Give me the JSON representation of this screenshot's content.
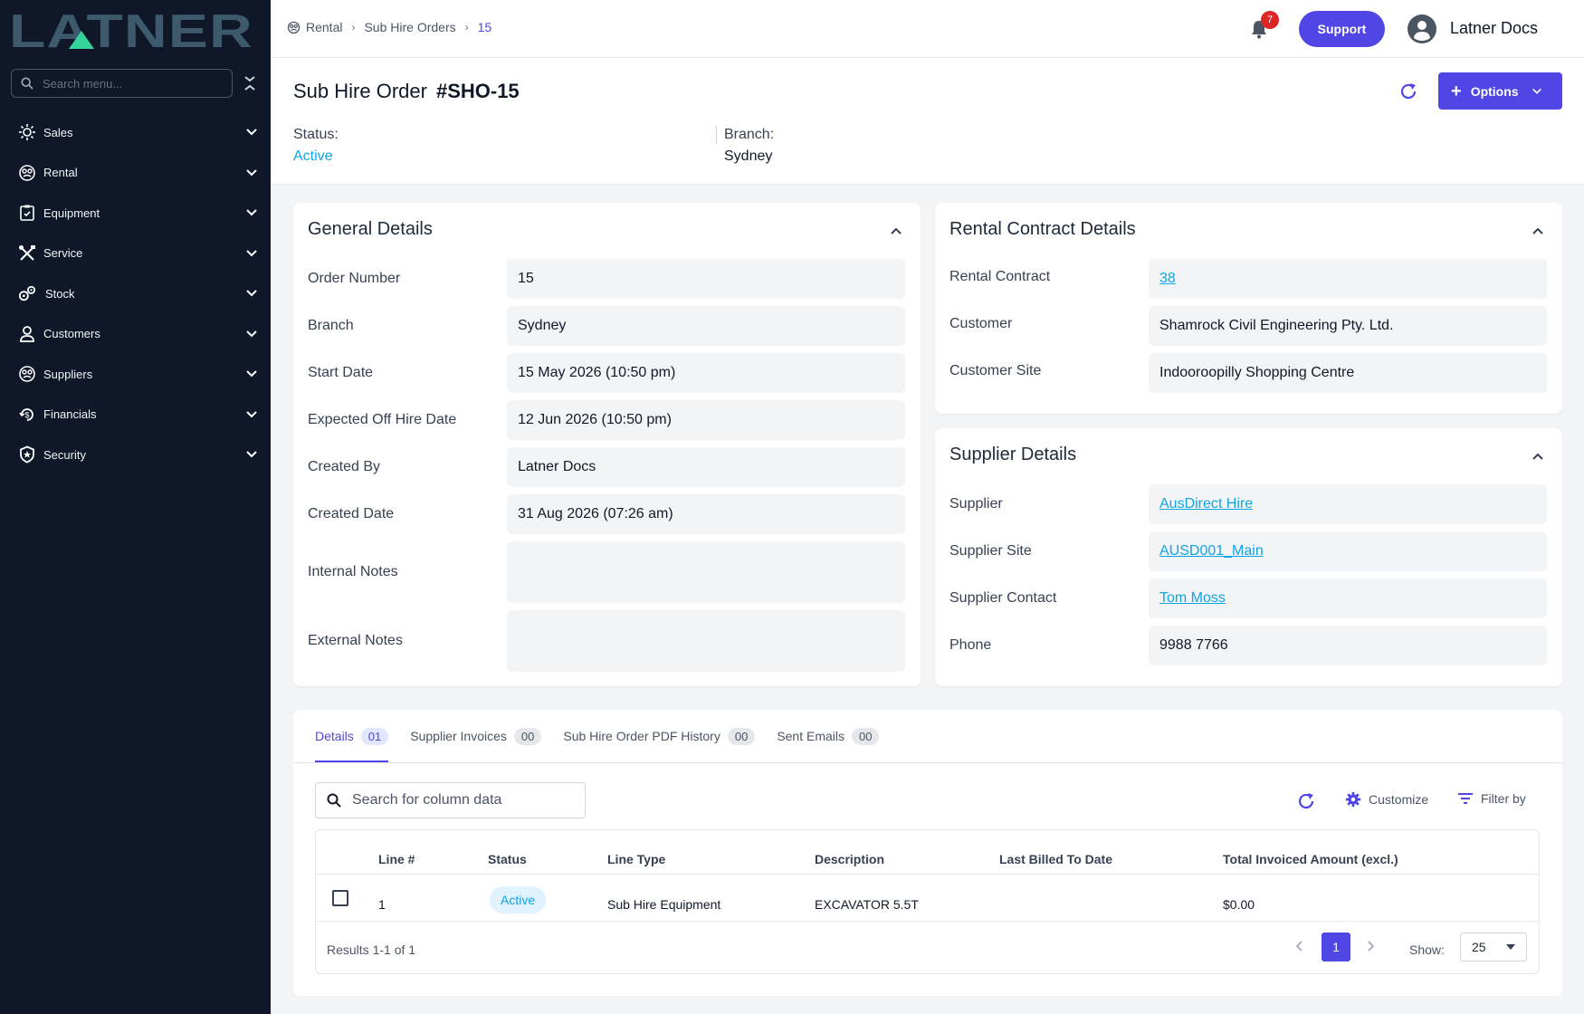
{
  "app": {
    "logo_text": "LATNER"
  },
  "sidebar": {
    "search_placeholder": "Search menu...",
    "items": [
      {
        "label": "Sales",
        "icon": "sun-icon"
      },
      {
        "label": "Rental",
        "icon": "rental-icon"
      },
      {
        "label": "Equipment",
        "icon": "clipboard-icon"
      },
      {
        "label": "Service",
        "icon": "tools-icon"
      },
      {
        "label": "Stock",
        "icon": "gears-icon"
      },
      {
        "label": "Customers",
        "icon": "person-icon"
      },
      {
        "label": "Suppliers",
        "icon": "supplier-icon"
      },
      {
        "label": "Financials",
        "icon": "dollar-icon"
      },
      {
        "label": "Security",
        "icon": "shield-icon"
      }
    ]
  },
  "topbar": {
    "breadcrumb": [
      "Rental",
      "Sub Hire Orders",
      "15"
    ],
    "notification_count": "7",
    "support_label": "Support",
    "user_name": "Latner Docs"
  },
  "header": {
    "title_prefix": "Sub Hire Order",
    "order_code": "#SHO-15",
    "options_label": "Options",
    "status_label": "Status:",
    "status_value": "Active",
    "branch_label": "Branch:",
    "branch_value": "Sydney"
  },
  "general": {
    "title": "General Details",
    "fields": [
      {
        "label": "Order Number",
        "value": "15"
      },
      {
        "label": "Branch",
        "value": "Sydney"
      },
      {
        "label": "Start Date",
        "value": "15 May 2026 (10:50 pm)"
      },
      {
        "label": "Expected Off Hire Date",
        "value": "12 Jun 2026 (10:50 pm)"
      },
      {
        "label": "Created By",
        "value": "Latner Docs"
      },
      {
        "label": "Created Date",
        "value": "31 Aug 2026 (07:26 am)"
      },
      {
        "label": "Internal Notes",
        "value": ""
      },
      {
        "label": "External Notes",
        "value": ""
      }
    ]
  },
  "rental_contract": {
    "title": "Rental Contract Details",
    "fields": [
      {
        "label": "Rental Contract",
        "value": "38"
      },
      {
        "label": "Customer",
        "value": "Shamrock Civil Engineering Pty. Ltd."
      },
      {
        "label": "Customer Site",
        "value": "Indooroopilly Shopping Centre"
      }
    ]
  },
  "supplier": {
    "title": "Supplier Details",
    "fields": [
      {
        "label": "Supplier",
        "value": "AusDirect Hire"
      },
      {
        "label": "Supplier Site",
        "value": "AUSD001_Main"
      },
      {
        "label": "Supplier Contact",
        "value": "Tom Moss"
      },
      {
        "label": "Phone",
        "value": "9988 7766"
      }
    ]
  },
  "tabs": [
    {
      "label": "Details",
      "count": "01"
    },
    {
      "label": "Supplier Invoices",
      "count": "00"
    },
    {
      "label": "Sub Hire Order PDF History",
      "count": "00"
    },
    {
      "label": "Sent Emails",
      "count": "00"
    }
  ],
  "grid": {
    "search_placeholder": "Search for column data",
    "customize_label": "Customize",
    "filter_label": "Filter by",
    "columns": [
      "Line #",
      "Status",
      "Line Type",
      "Description",
      "Last Billed To Date",
      "Total Invoiced Amount (excl.)"
    ],
    "rows": [
      {
        "line": "1",
        "status": "Active",
        "line_type": "Sub Hire Equipment",
        "description": "EXCAVATOR 5.5T",
        "last_billed": "",
        "total": "$0.00"
      }
    ],
    "results_text": "Results 1-1 of 1",
    "current_page": "1",
    "show_label": "Show:",
    "page_size": "25"
  },
  "colors": {
    "accent": "#4f46e5",
    "link": "#0ea5e9",
    "sidebar_bg": "#0f1729",
    "logo": "#3d5a6c",
    "logo_accent": "#34d399"
  }
}
